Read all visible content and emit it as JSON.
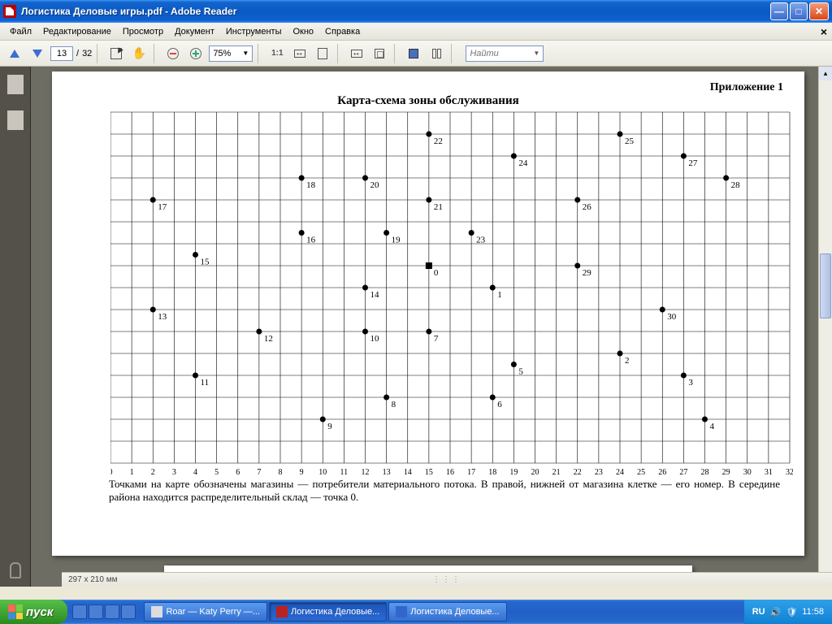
{
  "window": {
    "title": "Логистика Деловые игры.pdf - Adobe Reader"
  },
  "menu": {
    "items": [
      "Файл",
      "Редактирование",
      "Просмотр",
      "Документ",
      "Инструменты",
      "Окно",
      "Справка"
    ]
  },
  "toolbar": {
    "page_current": "13",
    "page_sep": "/",
    "page_total": "32",
    "zoom": "75%",
    "find_placeholder": "Найти"
  },
  "document": {
    "appendix": "Приложение 1",
    "title": "Карта-схема зоны обслуживания",
    "caption": "Точками на карте обозначены магазины — потребители материального потока. В правой, нижней от магазина клетке — его номер. В середине района находится распределительный склад — точка 0."
  },
  "footer": {
    "page_size": "297 x 210 мм"
  },
  "taskbar": {
    "start": "пуск",
    "tasks": [
      {
        "label": "Roar — Katy Perry —...",
        "active": false
      },
      {
        "label": "Логистика Деловые...",
        "active": true
      },
      {
        "label": "Логистика Деловые...",
        "active": false
      }
    ],
    "lang": "RU",
    "time": "11:58"
  },
  "chart_data": {
    "type": "scatter",
    "title": "Карта-схема зоны обслуживания",
    "xlabel": "",
    "ylabel": "",
    "xlim": [
      0,
      32
    ],
    "ylim": [
      0,
      16
    ],
    "grid": true,
    "x_ticks": [
      0,
      1,
      2,
      3,
      4,
      5,
      6,
      7,
      8,
      9,
      10,
      11,
      12,
      13,
      14,
      15,
      16,
      17,
      18,
      19,
      20,
      21,
      22,
      23,
      24,
      25,
      26,
      27,
      28,
      29,
      30,
      31,
      32
    ],
    "series": [
      {
        "name": "warehouse",
        "marker": "square",
        "points": [
          {
            "id": 0,
            "x": 15,
            "y": 9
          }
        ]
      },
      {
        "name": "stores",
        "marker": "circle",
        "points": [
          {
            "id": 1,
            "x": 18,
            "y": 8
          },
          {
            "id": 2,
            "x": 24,
            "y": 5
          },
          {
            "id": 3,
            "x": 27,
            "y": 4
          },
          {
            "id": 4,
            "x": 28,
            "y": 2
          },
          {
            "id": 5,
            "x": 19,
            "y": 4.5
          },
          {
            "id": 6,
            "x": 18,
            "y": 3
          },
          {
            "id": 7,
            "x": 15,
            "y": 6
          },
          {
            "id": 8,
            "x": 13,
            "y": 3
          },
          {
            "id": 9,
            "x": 10,
            "y": 2
          },
          {
            "id": 10,
            "x": 12,
            "y": 6
          },
          {
            "id": 11,
            "x": 4,
            "y": 4
          },
          {
            "id": 12,
            "x": 7,
            "y": 6
          },
          {
            "id": 13,
            "x": 2,
            "y": 7
          },
          {
            "id": 14,
            "x": 12,
            "y": 8
          },
          {
            "id": 15,
            "x": 4,
            "y": 9.5
          },
          {
            "id": 16,
            "x": 9,
            "y": 10.5
          },
          {
            "id": 17,
            "x": 2,
            "y": 12
          },
          {
            "id": 18,
            "x": 9,
            "y": 13
          },
          {
            "id": 19,
            "x": 13,
            "y": 10.5
          },
          {
            "id": 20,
            "x": 12,
            "y": 13
          },
          {
            "id": 21,
            "x": 15,
            "y": 12
          },
          {
            "id": 22,
            "x": 15,
            "y": 15
          },
          {
            "id": 23,
            "x": 17,
            "y": 10.5
          },
          {
            "id": 24,
            "x": 19,
            "y": 14
          },
          {
            "id": 25,
            "x": 24,
            "y": 15
          },
          {
            "id": 26,
            "x": 22,
            "y": 12
          },
          {
            "id": 27,
            "x": 27,
            "y": 14
          },
          {
            "id": 28,
            "x": 29,
            "y": 13
          },
          {
            "id": 29,
            "x": 22,
            "y": 9
          },
          {
            "id": 30,
            "x": 26,
            "y": 7
          }
        ]
      }
    ]
  }
}
